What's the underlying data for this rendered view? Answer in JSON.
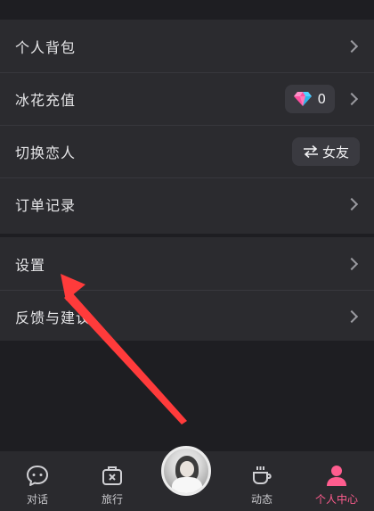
{
  "menu_group1": [
    {
      "label": "个人背包",
      "trailing": "chevron"
    },
    {
      "label": "冰花充值",
      "trailing": "diamond-pill",
      "value": "0"
    },
    {
      "label": "切换恋人",
      "trailing": "swap-pill",
      "value": "女友"
    },
    {
      "label": "订单记录",
      "trailing": "chevron"
    }
  ],
  "menu_group2": [
    {
      "label": "设置",
      "trailing": "chevron"
    },
    {
      "label": "反馈与建议",
      "trailing": "chevron"
    }
  ],
  "tabbar": {
    "tabs": [
      {
        "label": "对话",
        "icon": "chat-bubble-icon",
        "active": false
      },
      {
        "label": "旅行",
        "icon": "luggage-icon",
        "active": false
      },
      {
        "label": "动态",
        "icon": "coffee-cup-icon",
        "active": false
      },
      {
        "label": "个人中心",
        "icon": "person-icon",
        "active": true
      }
    ],
    "center_icon": "avatar"
  },
  "annotation": {
    "type": "red-arrow",
    "points_to": "设置"
  },
  "colors": {
    "background": "#1e1e22",
    "row_bg": "#2b2b2f",
    "active_tab": "#ff5d8f",
    "arrow": "#ff3b3b"
  }
}
